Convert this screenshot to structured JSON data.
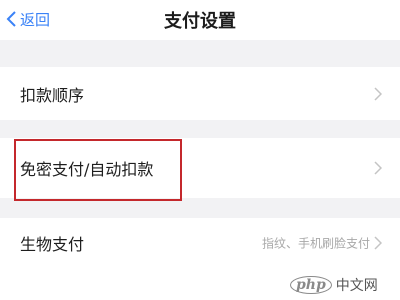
{
  "nav": {
    "back_label": "返回",
    "title": "支付设置"
  },
  "rows": [
    {
      "label": "扣款顺序",
      "value": ""
    },
    {
      "label": "免密支付/自动扣款",
      "value": ""
    },
    {
      "label": "生物支付",
      "value": "指纹、手机刷脸支付"
    }
  ],
  "watermark": {
    "logo": "php",
    "text": "中文网"
  },
  "colors": {
    "accent": "#3a82f7",
    "highlight_border": "#c4282c",
    "background": "#f2f2f4"
  },
  "icons": {
    "back": "chevron-left-icon",
    "row_arrow": "chevron-right-icon"
  }
}
